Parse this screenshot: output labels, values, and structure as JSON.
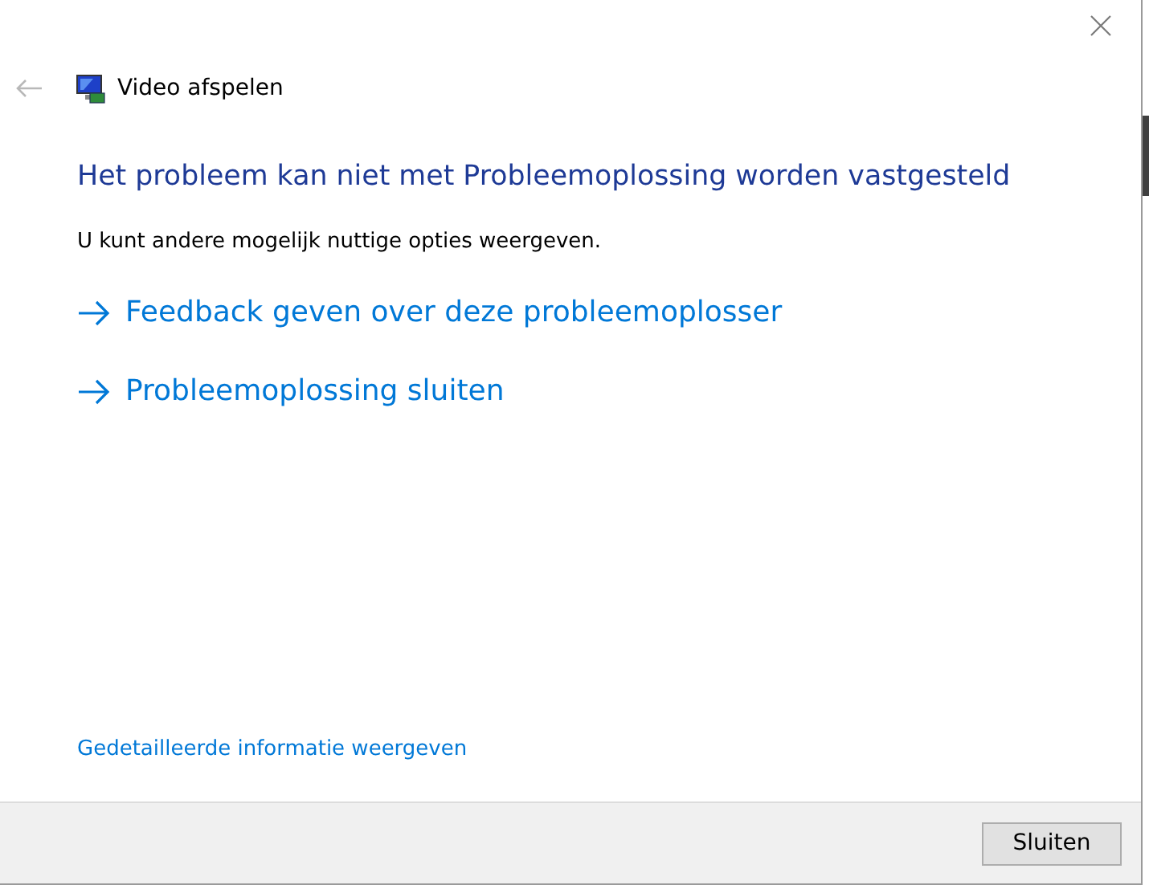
{
  "window": {
    "title": "Video afspelen"
  },
  "heading": "Het probleem kan niet met Probleemoplossing worden vastgesteld",
  "description": "U kunt andere mogelijk nuttige opties weergeven.",
  "options": [
    {
      "label": "Feedback geven over deze probleemoplosser"
    },
    {
      "label": "Probleemoplossing sluiten"
    }
  ],
  "details_link": "Gedetailleerde informatie weergeven",
  "buttons": [
    "Sluiten"
  ]
}
